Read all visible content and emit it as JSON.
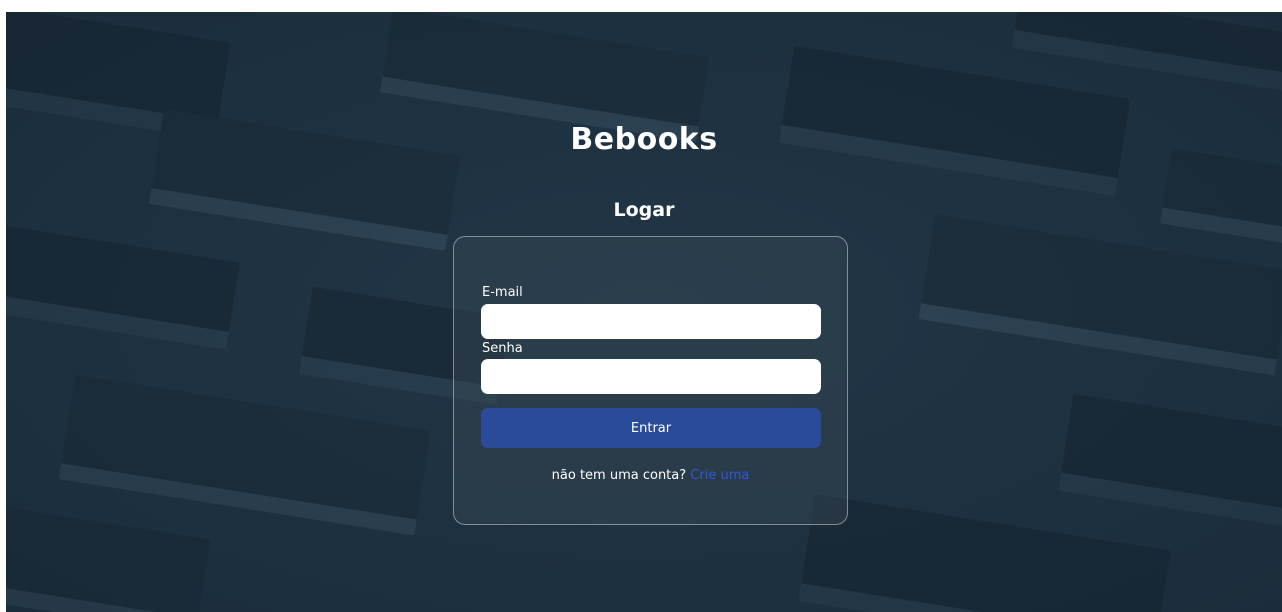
{
  "brand": {
    "title": "Bebooks"
  },
  "login": {
    "heading": "Logar",
    "email_label": "E-mail",
    "email_value": "",
    "password_label": "Senha",
    "password_value": "",
    "submit_label": "Entrar",
    "signup_prompt": "não tem uma conta?",
    "signup_link": "Crie uma"
  },
  "colors": {
    "background": "#213647",
    "button": "#2a4a9a",
    "link": "#2f5bd0",
    "text": "#ffffff"
  }
}
